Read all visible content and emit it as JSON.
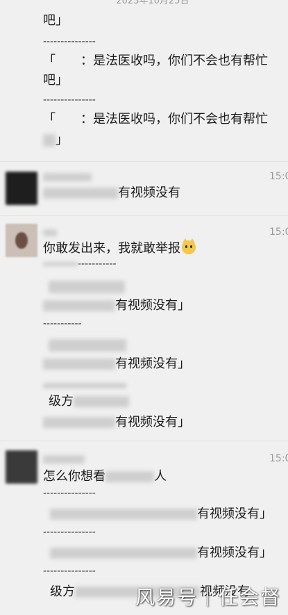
{
  "chat": {
    "date": "2023年10月25日",
    "top_block": {
      "line1": "吧」",
      "sep": "---------------",
      "quote1": "「　　：是法医收吗，你们不会也有帮忙",
      "quote1_end": "吧」",
      "quote2": "「　　：是法医收吗，你们不会也有帮忙",
      "quote2_end": "」"
    },
    "messages": [
      {
        "time": "15:0",
        "text": "有视频没有"
      },
      {
        "time": "15:0",
        "text": "你敢发出来，我就敢举报",
        "emoji": "cat-face-emoji",
        "sep": "-----------",
        "quotes": [
          "有视频没有」",
          "有视频没有」",
          "有视频没有」"
        ],
        "partial": "级方"
      },
      {
        "time": "15:0",
        "text": "怎么你想看",
        "text_tail": "人",
        "sep": "---------------",
        "quotes": [
          "有视频没有」",
          "有视频没有」",
          "视频没有"
        ],
        "partial": "级方"
      }
    ]
  },
  "watermark": "风易号｜任会督"
}
